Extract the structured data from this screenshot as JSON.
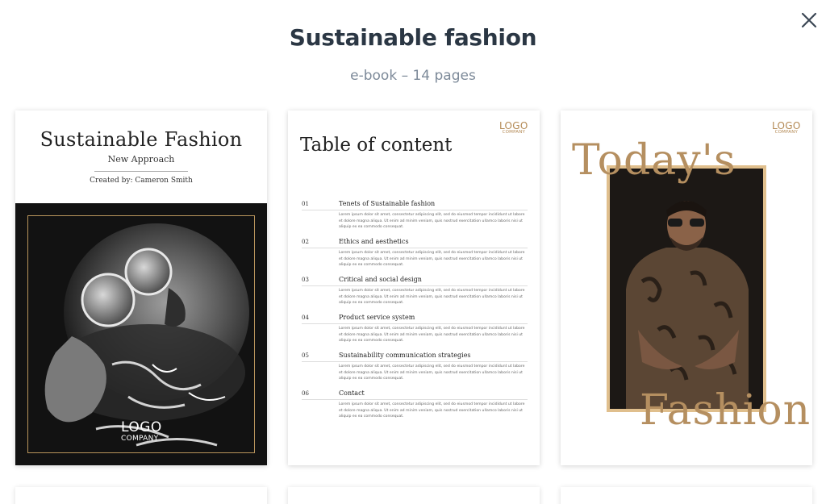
{
  "modal": {
    "title": "Sustainable fashion",
    "subtitle": "e-book – 14 pages",
    "close_icon": "close-icon"
  },
  "pages": {
    "cover": {
      "title": "Sustainable Fashion",
      "subtitle": "New Approach",
      "author": "Created by: Cameron Smith",
      "logo_line1": "LOGO",
      "logo_line2": "COMPANY"
    },
    "toc": {
      "title": "Table of content",
      "logo_line1": "LOGO",
      "logo_line2": "COMPANY",
      "body_text": "Lorem ipsum dolor sit amet, consectetur adipiscing elit, sed do eiusmod tempor incididunt ut labore et dolore magna aliqua. Ut enim ad minim veniam, quis nostrud exercitation ullamco laboris nisi ut aliquip ex ea commodo consequat.",
      "entries": [
        {
          "num": "01",
          "heading": "Tenets of Sustainable fashion"
        },
        {
          "num": "02",
          "heading": "Ethics and aesthetics"
        },
        {
          "num": "03",
          "heading": "Critical and social design"
        },
        {
          "num": "04",
          "heading": "Product service system"
        },
        {
          "num": "05",
          "heading": "Sustainability communication strategies"
        },
        {
          "num": "06",
          "heading": "Contact"
        }
      ]
    },
    "feature": {
      "word1": "Today's",
      "word2": "Fashion",
      "logo_line1": "LOGO",
      "logo_line2": "COMPANY"
    }
  },
  "colors": {
    "title": "#2b3744",
    "subtitle": "#7d8a99",
    "gold": "#b58f60",
    "gold_box": "#e0bf8d",
    "photo_dark": "#121212"
  }
}
